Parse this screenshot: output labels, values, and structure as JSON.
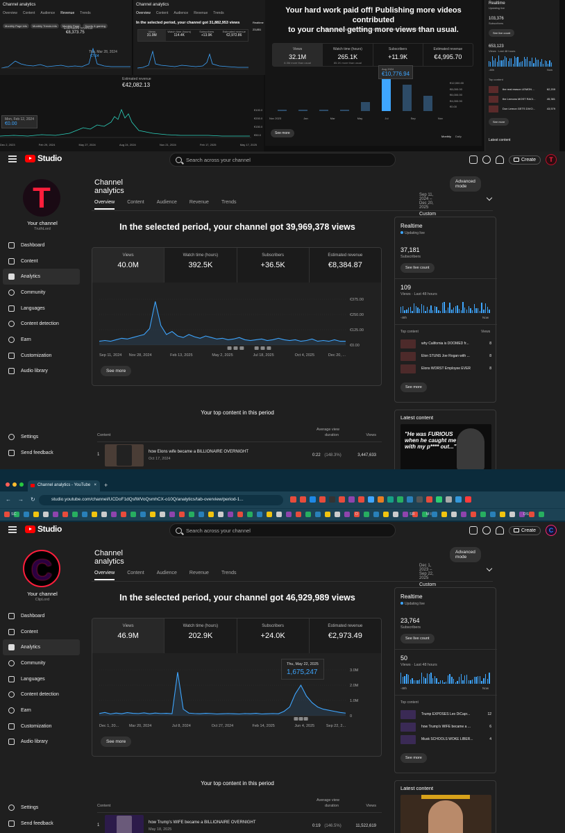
{
  "collage": {
    "shot1": {
      "title": "Channel analytics",
      "tabs": [
        "Overview",
        "Content",
        "Audience",
        "Revenue",
        "Trends"
      ],
      "active_tab": "Revenue",
      "chips": [
        "Monthly Page info",
        "Monthly Trends info",
        "Monthly Page",
        "Sports & gaming"
      ],
      "kpi_label": "Estimated revenue",
      "kpi_value": "€8,373.75",
      "tooltip_value": "€7.64",
      "tooltip_date": "Thu, Mar 28, 2024"
    },
    "shot2": {
      "title": "Channel analytics",
      "tabs": [
        "Overview",
        "Content",
        "Audience",
        "Revenue",
        "Trends"
      ],
      "headline": "In the selected period, your channel got 31,882,953 views",
      "kpis": [
        {
          "label": "Views",
          "value": "31.9M"
        },
        {
          "label": "Watch time (hours)",
          "value": "114.4K"
        },
        {
          "label": "Subscribers",
          "value": "+13.9K"
        },
        {
          "label": "Estimated revenue",
          "value": "€2,972.86"
        }
      ],
      "side_title": "Realtime",
      "side_value": "23,851"
    },
    "shot3": {
      "kpi_label": "Estimated revenue",
      "kpi_value": "€42,082.13",
      "tooltip_date": "Mon, Feb 12, 2024",
      "tooltip_value": "€0.00",
      "y_ticks": [
        "€100.0",
        "€200.0",
        "€150.0",
        "€50.0"
      ],
      "x_ticks": [
        "Dec 2, 2023",
        "Feb 29, 2024",
        "May 27, 2024",
        "Aug 24, 2024",
        "Nov 21, 2024",
        "Feb 17, 2025",
        "May 17, 2025"
      ]
    },
    "shot4": {
      "headline_1": "Your hard work paid off! Publishing more videos contributed",
      "headline_2": "to your channel getting more views than usual.",
      "sub": "Meanwhile, your channel's subscriber count grew at a typical rate",
      "kpis": [
        {
          "label": "Views",
          "value": "32.1M",
          "note": "8.3M more than usual"
        },
        {
          "label": "Watch time (hours)",
          "value": "265.1K",
          "note": "85.1K more than usual"
        },
        {
          "label": "Subscribers",
          "value": "+11.9K",
          "note": ""
        },
        {
          "label": "Estimated revenue",
          "value": "€4,995.70",
          "note": ""
        }
      ],
      "tooltip_date": "Aug 2024",
      "tooltip_value": "€10,776.94",
      "y_ticks": [
        "€12,000.00",
        "€8,000.00",
        "€6,000.00",
        "€4,000.00",
        "€0.00"
      ],
      "x_ticks": [
        "Nov 2023",
        "Jan",
        "Mar",
        "May",
        "Jul",
        "Sep",
        "Nov"
      ],
      "see_more": "See more",
      "toggle": [
        "Monthly",
        "Daily"
      ]
    },
    "shot5": {
      "title": "Realtime",
      "live": "Updating live",
      "subs": "103,376",
      "subs_label": "Subscribers",
      "live_btn": "See live count",
      "views": "653,123",
      "views_label": "Views · Last 48 hours",
      "range": [
        "-48h",
        "Now"
      ],
      "top_label": "Top content",
      "items": [
        {
          "title": "the real reason LEMON ...",
          "views": "62,209"
        },
        {
          "title": "the Lemons MOST RACI...",
          "views": "45,381"
        },
        {
          "title": "Don Lemon GETS DIVO...",
          "views": "43,579"
        }
      ],
      "see_more": "See more",
      "latest": "Latest content"
    }
  },
  "studio_a": {
    "search_placeholder": "Search across your channel",
    "logo_text": "Studio",
    "create_label": "Create",
    "avatar_letter": "T",
    "channel_label": "Your channel",
    "channel_name": "TruthLord",
    "nav": [
      "Dashboard",
      "Content",
      "Analytics",
      "Community",
      "Languages",
      "Content detection",
      "Earn",
      "Customization",
      "Audio library"
    ],
    "bottom_nav": [
      "Settings",
      "Send feedback"
    ],
    "page_title": "Channel analytics",
    "advanced": "Advanced mode",
    "tabs": [
      "Overview",
      "Content",
      "Audience",
      "Revenue",
      "Trends"
    ],
    "period_range": "Sep 11, 2024 – Dec 20, 2025",
    "period_label": "Custom",
    "headline": "In the selected period, your channel got 39,969,378 views",
    "kpis": [
      {
        "label": "Views",
        "value": "40.0M"
      },
      {
        "label": "Watch time (hours)",
        "value": "392.5K"
      },
      {
        "label": "Subscribers",
        "value": "+36.5K"
      },
      {
        "label": "Estimated revenue",
        "value": "€8,384.87"
      }
    ],
    "see_more": "See more",
    "top_title": "Your top content in this period",
    "table_headers": {
      "content": "Content",
      "avd_1": "Average view",
      "avd_2": "duration",
      "views": "Views"
    },
    "top_row": {
      "rank": "1",
      "title": "how Elons wife became a BILLIONAIRE OVERNIGHT",
      "date": "Oct 17, 2024",
      "duration": "0:22",
      "pct": "(148.3%)",
      "views": "3,447,633"
    },
    "realtime": {
      "title": "Realtime",
      "live": "Updating live",
      "subs": "37,181",
      "subs_label": "Subscribers",
      "live_btn": "See live count",
      "views": "109",
      "views_label": "Views · Last 48 hours",
      "range": [
        "-48h",
        "Now"
      ],
      "top_label": "Top content",
      "top_views_label": "Views",
      "items": [
        {
          "title": "why California is DOOMED fr...",
          "views": "8"
        },
        {
          "title": "Elon STUNS Joe Rogan with ...",
          "views": "8"
        },
        {
          "title": "Elons WORST Employee EVER",
          "views": "8"
        }
      ],
      "see_more": "See more"
    },
    "latest": {
      "title": "Latest content",
      "caption_1": "\"He was FURIOUS",
      "caption_2": "when he caught me",
      "caption_3": "with my p**** out...\""
    }
  },
  "browser": {
    "tab_title": "Channel analytics - YouTube",
    "url": "studio.youtube.com/channel/UCDoF1dQsfWVoQsmhCX-o10Q/analytics/tab-overview/period-1...",
    "bookmarks": [
      "SC",
      "D",
      "SR",
      "M I",
      "DS"
    ]
  },
  "studio_b": {
    "search_placeholder": "Search across your channel",
    "logo_text": "Studio",
    "create_label": "Create",
    "avatar_letter": "C",
    "channel_label": "Your channel",
    "channel_name": "ClipLord",
    "nav": [
      "Dashboard",
      "Content",
      "Analytics",
      "Community",
      "Languages",
      "Content detection",
      "Earn",
      "Customization",
      "Audio library"
    ],
    "bottom_nav": [
      "Settings",
      "Send feedback"
    ],
    "page_title": "Channel analytics",
    "advanced": "Advanced mode",
    "tabs": [
      "Overview",
      "Content",
      "Audience",
      "Revenue",
      "Trends"
    ],
    "period_range": "Dec 1, 2023 – Sep 22, 2025",
    "period_label": "Custom",
    "headline": "In the selected period, your channel got 46,929,989 views",
    "kpis": [
      {
        "label": "Views",
        "value": "46.9M"
      },
      {
        "label": "Watch time (hours)",
        "value": "202.9K"
      },
      {
        "label": "Subscribers",
        "value": "+24.0K"
      },
      {
        "label": "Estimated revenue",
        "value": "€2,973.49"
      }
    ],
    "tooltip": {
      "date": "Thu, May 22, 2025",
      "value": "1,675,247"
    },
    "see_more": "See more",
    "top_title": "Your top content in this period",
    "table_headers": {
      "content": "Content",
      "avd_1": "Average view",
      "avd_2": "duration",
      "views": "Views"
    },
    "top_row": {
      "rank": "1",
      "title": "how Trump's WIFE became a BILLIONAIRE OVERNIGHT",
      "date": "May 18, 2025",
      "duration": "0:19",
      "pct": "(146.5%)",
      "views": "11,522,619"
    },
    "realtime": {
      "title": "Realtime",
      "live": "Updating live",
      "subs": "23,764",
      "subs_label": "Subscribers",
      "live_btn": "See live count",
      "views": "50",
      "views_label": "Views · Last 48 hours",
      "range": [
        "-48h",
        "Now"
      ],
      "top_label": "Top content",
      "items": [
        {
          "title": "Trump EXPOSES Leo DiCapr...",
          "views": "12"
        },
        {
          "title": "how Trump's WIFE became a ...",
          "views": "6"
        },
        {
          "title": "Musk SCHOOLS WOKE LIBER...",
          "views": "4"
        }
      ],
      "see_more": "See more"
    },
    "latest": {
      "title": "Latest content"
    }
  },
  "chart_data": [
    {
      "type": "line",
      "title": "",
      "series": [
        {
          "values": [
            5,
            6,
            5,
            7,
            9,
            8,
            10,
            12,
            14,
            22,
            58,
            26,
            14,
            18,
            12,
            10,
            14,
            11,
            9,
            12,
            10,
            8,
            9,
            7,
            8,
            10,
            7,
            6,
            7,
            8,
            6,
            7,
            9,
            7,
            6,
            7,
            5,
            6,
            8,
            5,
            6,
            5,
            7,
            5,
            5
          ]
        }
      ],
      "x_ticks": [
        "Sep 11, 2024",
        "Nov 28, 2024",
        "Feb 13, 2025",
        "May 2, 2025",
        "Jul 18, 2025",
        "Oct 4, 2025",
        "Dec 20, ..."
      ],
      "y_ticks": [
        "€0.00",
        "€125.00",
        "€250.00",
        "€375.00"
      ],
      "ylim": [
        0,
        375
      ],
      "color": "#3ea6ff"
    },
    {
      "type": "line",
      "title": "",
      "series": [
        {
          "values": [
            10,
            15,
            8,
            12,
            9,
            14,
            11,
            10,
            13,
            9,
            12,
            10,
            11,
            9,
            200,
            30,
            12,
            10,
            9,
            11,
            10,
            8,
            9,
            10,
            9,
            8,
            10,
            9,
            11,
            8,
            9,
            10,
            9,
            20,
            40,
            100,
            140,
            90,
            60,
            40,
            30,
            25,
            20,
            15,
            12
          ]
        }
      ],
      "x_ticks": [
        "Dec 1, 20...",
        "Mar 20, 2024",
        "Jul 8, 2024",
        "Oct 27, 2024",
        "Feb 14, 2025",
        "Jun 4, 2025",
        "Sep 22, 2..."
      ],
      "y_ticks": [
        "0",
        "1.0M",
        "2.0M",
        "3.0M"
      ],
      "ylim": [
        0,
        3000000
      ],
      "color": "#3ea6ff"
    },
    {
      "type": "bar",
      "title": "",
      "categories": [
        "Nov 2023",
        "Jan",
        "Mar",
        "May",
        "Jul",
        "Aug 2024",
        "Sep",
        "Nov"
      ],
      "values": [
        0,
        0,
        0,
        0,
        3000,
        10776.94,
        8500,
        5000
      ],
      "color": "#3ea6ff"
    }
  ]
}
